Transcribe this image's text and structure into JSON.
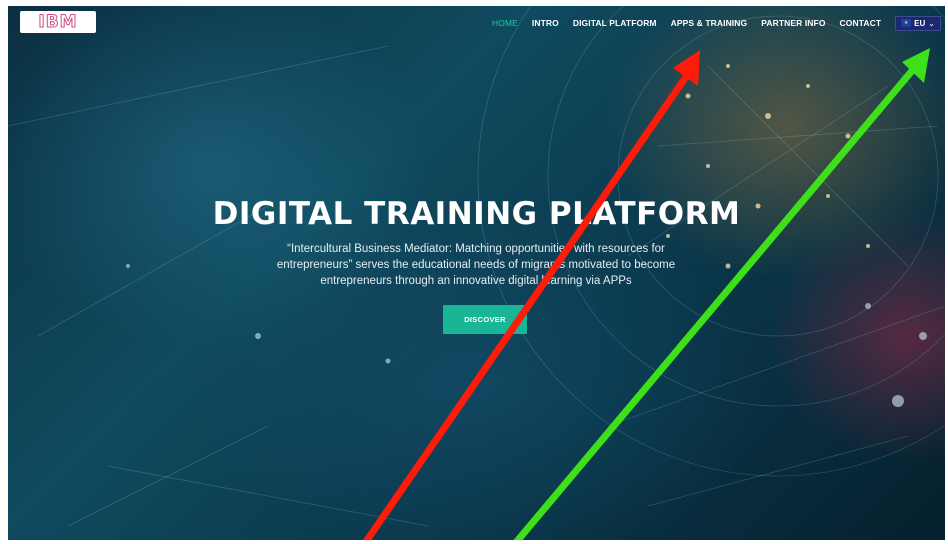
{
  "logo": {
    "text": "IBM"
  },
  "nav": {
    "items": [
      {
        "label": "HOME",
        "active": true
      },
      {
        "label": "INTRO"
      },
      {
        "label": "DIGITAL PLATFORM"
      },
      {
        "label": "APPS & TRAINING"
      },
      {
        "label": "PARTNER INFO"
      },
      {
        "label": "CONTACT"
      }
    ],
    "language": {
      "label": "EU",
      "icon": "eu-flag-icon"
    }
  },
  "hero": {
    "title": "DIGITAL TRAINING PLATFORM",
    "description": "“Intercultural Business Mediator: Matching opportunities with resources for entrepreneurs” serves the educational needs of migrants motivated to become entrepreneurs through an innovative digital learning via APPs",
    "button_label": "DISCOVER"
  },
  "annotations": {
    "red_arrow_color": "#ff1a0a",
    "green_arrow_color": "#3ee01a"
  },
  "colors": {
    "accent": "#18b597",
    "nav_active": "#1fc8a3"
  }
}
